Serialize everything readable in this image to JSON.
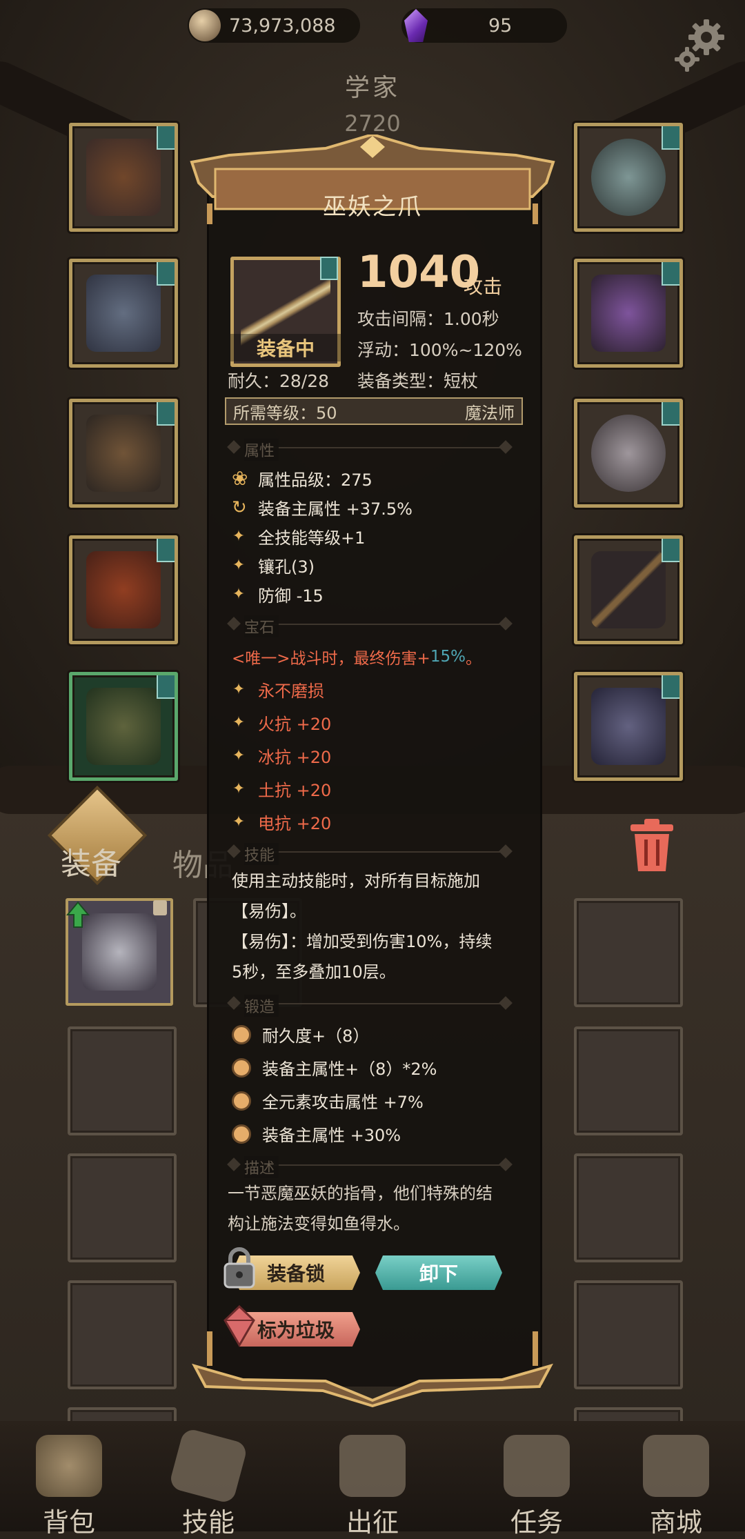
{
  "top_bar": {
    "gold_amount": "73,973,088",
    "gem_amount": "95",
    "gear_icon": "gear-icon"
  },
  "character": {
    "class_name": "学家",
    "score": "2720"
  },
  "tabs": {
    "equipment": "装备",
    "items": "物品"
  },
  "item_popup": {
    "name": "巫妖之爪",
    "equipped_label": "装备中",
    "attack_value": "1040",
    "attack_unit": "攻击",
    "attack_interval": "攻击间隔：1.00秒",
    "float_range": "浮动：100%~120%",
    "durability": "耐久：28/28",
    "equip_type": "装备类型：短杖",
    "required_level": "所需等级：50",
    "required_class": "魔法师",
    "section_attributes": "属性",
    "attr_quality": "属性品级：275",
    "attr_main": "装备主属性 +37.5%",
    "attr_skill": "全技能等级+1",
    "attr_socket": "镶孔(3)",
    "attr_defense": "防御 -15",
    "section_gems": "宝石",
    "unique_prefix": "<唯一>战斗时，最终伤害+",
    "unique_value": "15%",
    "unique_suffix": "。",
    "gem_effects": [
      "永不磨损",
      "火抗 +20",
      "冰抗 +20",
      "土抗 +20",
      "电抗 +20"
    ],
    "section_skill": "技能",
    "skill_line1": "使用主动技能时，对所有目标施加",
    "skill_line2": "【易伤】。",
    "skill_line3": "【易伤】：增加受到伤害10%，持续",
    "skill_line4": "5秒，至多叠加10层。",
    "section_forge": "锻造",
    "forge_effects": [
      "耐久度+（8）",
      "装备主属性+（8）*2%",
      "全元素攻击属性 +7%",
      "装备主属性 +30%"
    ],
    "section_desc": "描述",
    "description_line1": "一节恶魔巫妖的指骨，他们特殊的结",
    "description_line2": "构让施法变得如鱼得水。",
    "btn_lock": "装备锁",
    "btn_unequip": "卸下",
    "btn_junk": "标为垃圾"
  },
  "bottom_nav": {
    "bag": "背包",
    "skills": "技能",
    "expedition": "出征",
    "quests": "任务",
    "shop": "商城"
  },
  "colors": {
    "gold_accent": "#f2cfa0",
    "unique_red": "#ef6a4a",
    "unique_teal": "#4fa6b4",
    "unequip_teal": "#3a9a92"
  }
}
